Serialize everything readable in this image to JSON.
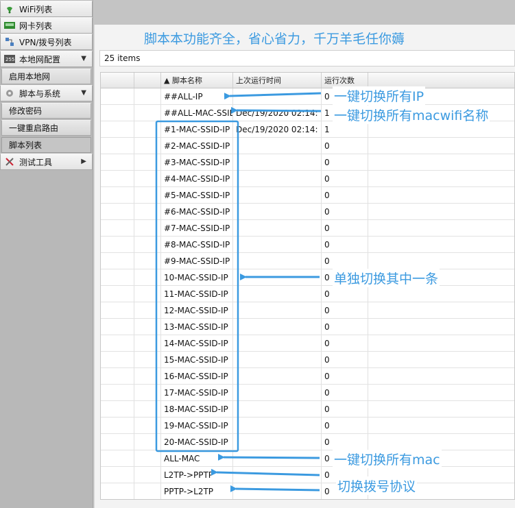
{
  "sidebar": {
    "items": [
      {
        "label": "WiFi列表",
        "icon": "wifi-icon"
      },
      {
        "label": "网卡列表",
        "icon": "network-card-icon"
      },
      {
        "label": "VPN/拨号列表",
        "icon": "vpn-icon"
      },
      {
        "label": "本地网配置",
        "icon": "lan-icon",
        "expanded": true
      },
      {
        "label": "启用本地网",
        "sub": true
      },
      {
        "label": "脚本与系统",
        "icon": "gear-icon",
        "expanded": true
      },
      {
        "label": "修改密码",
        "sub": true
      },
      {
        "label": "一键重启路由",
        "sub": true
      },
      {
        "label": "脚本列表",
        "sub": true,
        "selected": true
      },
      {
        "label": "测试工具",
        "icon": "tools-icon"
      }
    ]
  },
  "banner": "脚本本功能齐全，省心省力，千万羊毛任你薅",
  "items_count": "25 items",
  "table": {
    "columns": [
      "",
      "",
      "▲ 脚本名称",
      "上次运行时间",
      "运行次数",
      ""
    ],
    "rows": [
      {
        "name": "##ALL-IP",
        "time": "",
        "count": "0"
      },
      {
        "name": "##ALL-MAC-SSID",
        "time": "Dec/19/2020 02:14:",
        "count": "1"
      },
      {
        "name": "#1-MAC-SSID-IP",
        "time": "Dec/19/2020 02:14:",
        "count": "1"
      },
      {
        "name": "#2-MAC-SSID-IP",
        "time": "",
        "count": "0"
      },
      {
        "name": "#3-MAC-SSID-IP",
        "time": "",
        "count": "0"
      },
      {
        "name": "#4-MAC-SSID-IP",
        "time": "",
        "count": "0"
      },
      {
        "name": "#5-MAC-SSID-IP",
        "time": "",
        "count": "0"
      },
      {
        "name": "#6-MAC-SSID-IP",
        "time": "",
        "count": "0"
      },
      {
        "name": "#7-MAC-SSID-IP",
        "time": "",
        "count": "0"
      },
      {
        "name": "#8-MAC-SSID-IP",
        "time": "",
        "count": "0"
      },
      {
        "name": "#9-MAC-SSID-IP",
        "time": "",
        "count": "0"
      },
      {
        "name": "10-MAC-SSID-IP",
        "time": "",
        "count": "0"
      },
      {
        "name": "11-MAC-SSID-IP",
        "time": "",
        "count": "0"
      },
      {
        "name": "12-MAC-SSID-IP",
        "time": "",
        "count": "0"
      },
      {
        "name": "13-MAC-SSID-IP",
        "time": "",
        "count": "0"
      },
      {
        "name": "14-MAC-SSID-IP",
        "time": "",
        "count": "0"
      },
      {
        "name": "15-MAC-SSID-IP",
        "time": "",
        "count": "0"
      },
      {
        "name": "16-MAC-SSID-IP",
        "time": "",
        "count": "0"
      },
      {
        "name": "17-MAC-SSID-IP",
        "time": "",
        "count": "0"
      },
      {
        "name": "18-MAC-SSID-IP",
        "time": "",
        "count": "0"
      },
      {
        "name": "19-MAC-SSID-IP",
        "time": "",
        "count": "0"
      },
      {
        "name": "20-MAC-SSID-IP",
        "time": "",
        "count": "0"
      },
      {
        "name": "ALL-MAC",
        "time": "",
        "count": "0"
      },
      {
        "name": "L2TP->PPTP",
        "time": "",
        "count": "0"
      },
      {
        "name": "PPTP->L2TP",
        "time": "",
        "count": "0"
      }
    ]
  },
  "annotations": {
    "all_ip": "一键切换所有IP",
    "all_ssid": "一键切换所有macwifi名称",
    "single": "单独切换其中一条",
    "all_mac": "一键切换所有mac",
    "dial": "切换拨号协议"
  },
  "colors": {
    "accent": "#3b9ae0"
  }
}
